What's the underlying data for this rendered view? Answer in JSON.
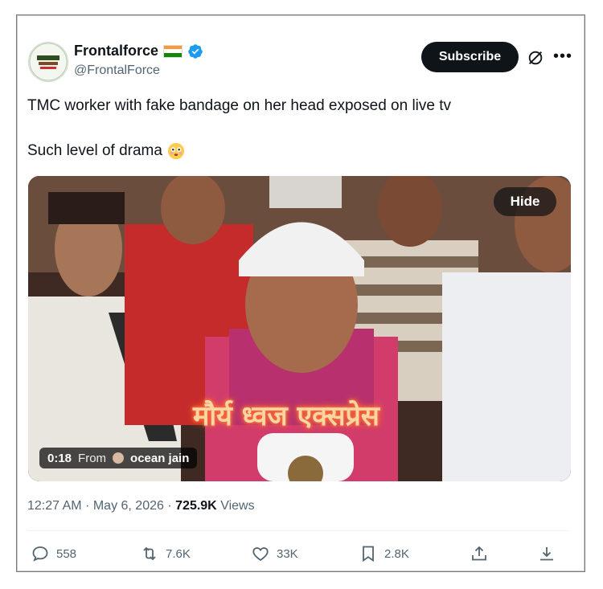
{
  "author": {
    "name": "Frontalforce",
    "handle": "@FrontalForce",
    "flag": "india-flag",
    "verified": "verified-badge"
  },
  "actions_top": {
    "subscribe_label": "Subscribe",
    "grok_icon": "grok-icon",
    "more_icon": "more-icon"
  },
  "tweet": {
    "line1": "TMC worker with fake bandage on her head exposed on live tv",
    "line2": "Such level of drama",
    "emoji": "flushed-face-emoji"
  },
  "media": {
    "hide_label": "Hide",
    "duration": "0:18",
    "from_label": "From",
    "source_name": "ocean jain",
    "overlay_caption": "मौर्य ध्वज एक्सप्रेस"
  },
  "meta": {
    "time": "12:27 AM",
    "date": "May 6, 2026",
    "views_count": "725.9K",
    "views_label": "Views"
  },
  "engagement": {
    "replies": "558",
    "reposts": "7.6K",
    "likes": "33K",
    "bookmarks": "2.8K"
  },
  "colors": {
    "text": "#0f1419",
    "muted": "#536471",
    "verified": "#1d9bf0",
    "saffron": "#ff9933",
    "green": "#138808"
  }
}
